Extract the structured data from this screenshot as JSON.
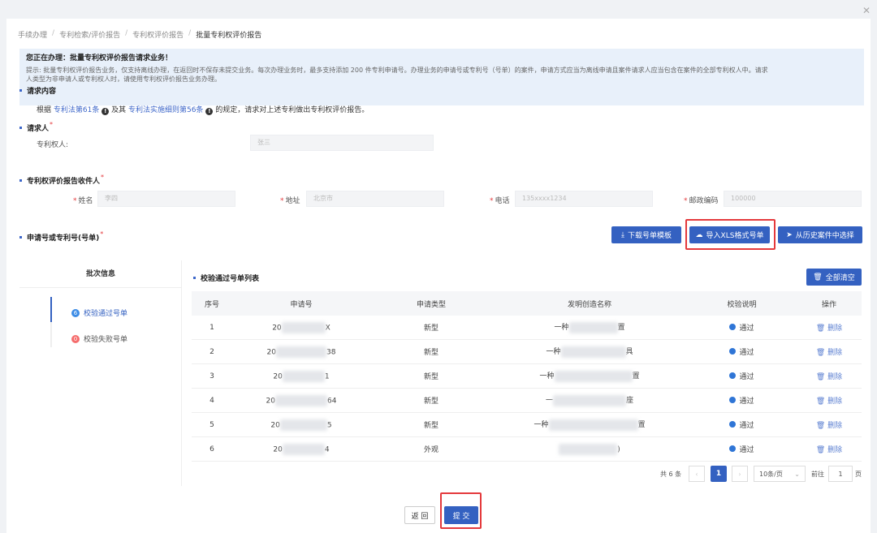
{
  "close_icon": "close-icon",
  "breadcrumb": [
    "手续办理",
    "专利检索/评价报告",
    "专利权评价报告",
    "批量专利权评价报告"
  ],
  "notice": {
    "title": "您正在办理：批量专利权评价报告请求业务！",
    "line1": "提示: 批量专利权评价报告业务，仅支持离线办理，在返回时不保存未提交业务。每次办理业务时，最多支持添加 200 件专利申请号。办理业务的申请号或专利号（号单）的案件，申请方式应当为离线申请且案件请求人应当包含在案件的全部专利权人中。请求",
    "line2": "人类型为非申请人或专利权人时，请使用专利权评价报告业务办理。"
  },
  "request_content": {
    "title": "请求内容",
    "prefix": "根据",
    "link1": "专利法第61条",
    "mid": "及其",
    "link2": "专利法实施细则第56条",
    "suffix": "的规定，请求对上述专利做出专利权评价报告。"
  },
  "requester": {
    "title": "请求人",
    "patentee_label": "专利权人:",
    "patentee_value": "张三"
  },
  "recipient": {
    "title": "专利权评价报告收件人",
    "name_label": "姓名",
    "name_value": "李四",
    "address_label": "地址",
    "address_value": "北京市",
    "phone_label": "电话",
    "phone_value": "135xxxx1234",
    "postcode_label": "邮政编码",
    "postcode_value": "100000"
  },
  "number_section": {
    "title": "申请号或专利号(号单)",
    "download_btn": "下载号单模板",
    "import_btn": "导入XLS格式号单",
    "history_btn": "从历史案件中选择"
  },
  "batch": {
    "header": "批次信息",
    "passed_label": "校验通过号单",
    "passed_count": "6",
    "failed_label": "校验失败号单",
    "failed_count": "0"
  },
  "table": {
    "title": "校验通过号单列表",
    "clear_btn": "全部清空",
    "columns": [
      "序号",
      "申请号",
      "申请类型",
      "发明创造名称",
      "校验说明",
      "操作"
    ],
    "rows": [
      {
        "no": "1",
        "app_prefix": "20",
        "app_suffix": "X",
        "type": "新型",
        "name_prefix": "一种",
        "name_suffix": "置",
        "status": "通过",
        "action": "删除"
      },
      {
        "no": "2",
        "app_prefix": "20",
        "app_suffix": "38",
        "type": "新型",
        "name_prefix": "一种",
        "name_suffix": "具",
        "status": "通过",
        "action": "删除"
      },
      {
        "no": "3",
        "app_prefix": "20",
        "app_suffix": "1",
        "type": "新型",
        "name_prefix": "一种",
        "name_suffix": "置",
        "status": "通过",
        "action": "删除"
      },
      {
        "no": "4",
        "app_prefix": "20",
        "app_suffix": "64",
        "type": "新型",
        "name_prefix": "一",
        "name_suffix": "座",
        "status": "通过",
        "action": "删除"
      },
      {
        "no": "5",
        "app_prefix": "20",
        "app_suffix": "5",
        "type": "新型",
        "name_prefix": "一种",
        "name_suffix": "置",
        "status": "通过",
        "action": "删除"
      },
      {
        "no": "6",
        "app_prefix": "20",
        "app_suffix": "4",
        "type": "外观",
        "name_prefix": "",
        "name_suffix": ")",
        "status": "通过",
        "action": "删除"
      }
    ]
  },
  "pagination": {
    "total": "共 6 条",
    "current_page": "1",
    "page_size": "10条/页",
    "goto_label": "前往",
    "goto_value": "1",
    "page_unit": "页"
  },
  "footer": {
    "back_btn": "返 回",
    "submit_btn": "提 交"
  },
  "colors": {
    "primary": "#3461c1",
    "highlight": "#e4393c",
    "pass_dot": "#2f75d6",
    "fail_badge": "#f56c6c"
  }
}
